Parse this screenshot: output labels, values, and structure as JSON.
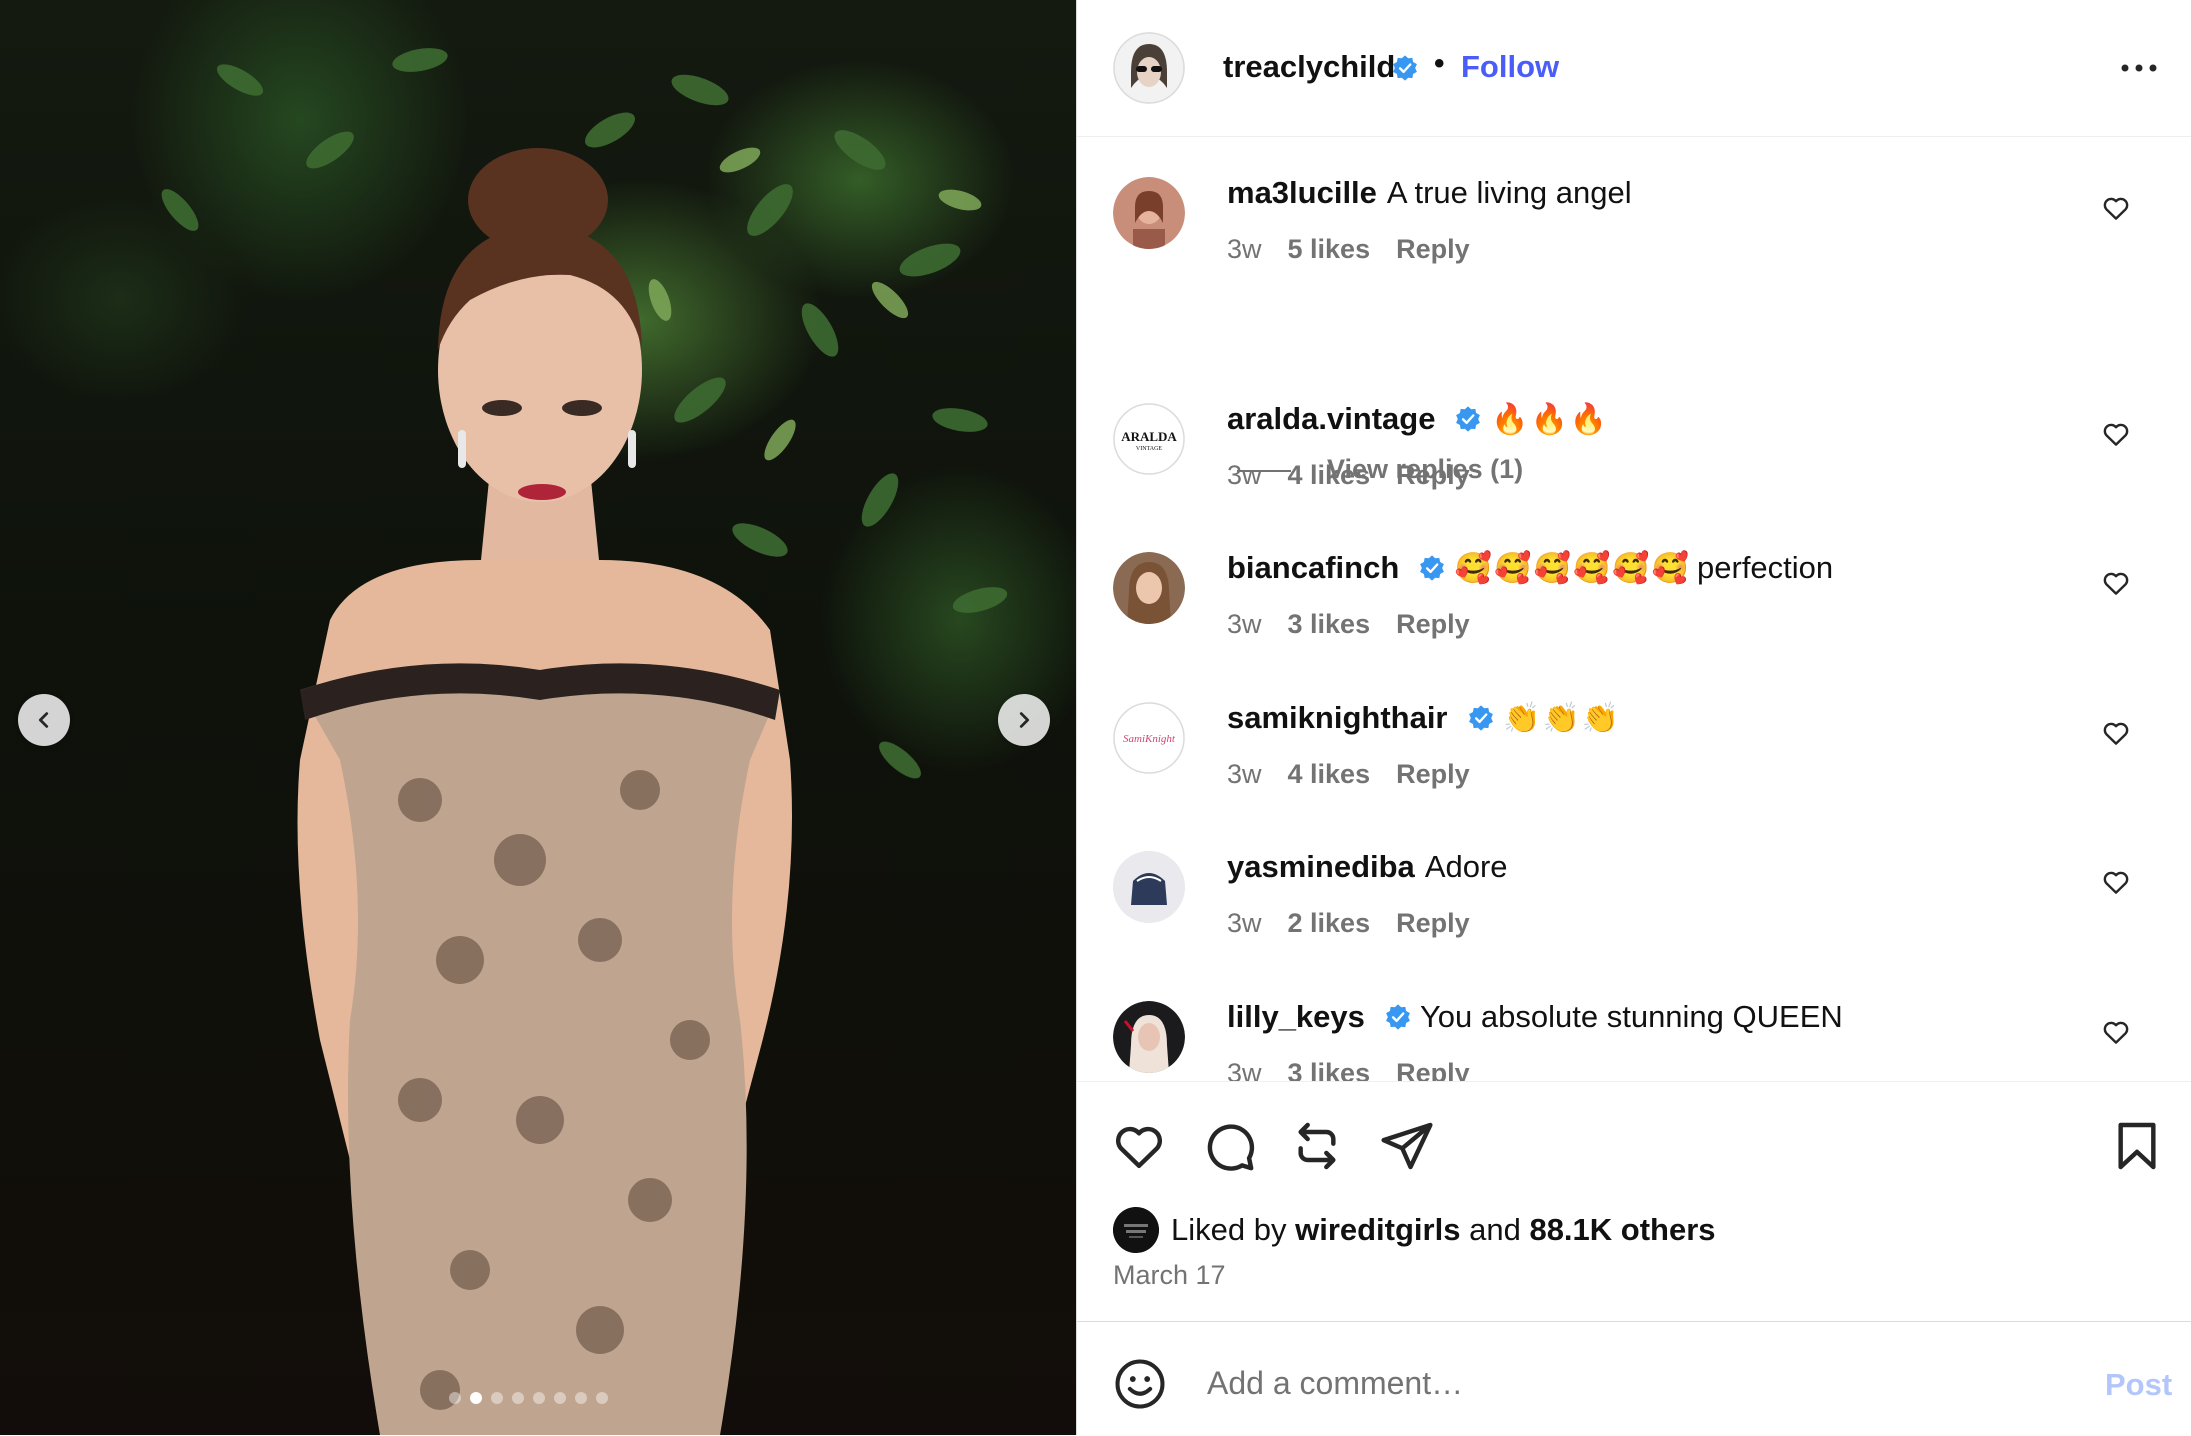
{
  "post": {
    "username": "treaclychild",
    "follow_label": "Follow",
    "separator": "•",
    "carousel_slide_count": 8,
    "carousel_active_index": 1
  },
  "comments": [
    {
      "username": "ma3lucille",
      "verified": false,
      "text": "A true living angel",
      "time": "3w",
      "likes": "5 likes",
      "reply": "Reply",
      "view_replies": "View replies (1)"
    },
    {
      "username": "aralda.vintage",
      "verified": true,
      "emoji": "🔥🔥🔥",
      "text": "",
      "time": "3w",
      "likes": "4 likes",
      "reply": "Reply",
      "avatar_text": "ARALDA",
      "avatar_subtext": "VINTAGE"
    },
    {
      "username": "biancafinch",
      "verified": true,
      "emoji": "🥰🥰🥰🥰🥰🥰",
      "text": "perfection",
      "time": "3w",
      "likes": "3 likes",
      "reply": "Reply"
    },
    {
      "username": "samiknighthair",
      "verified": true,
      "emoji": "👏👏👏",
      "text": "",
      "time": "3w",
      "likes": "4 likes",
      "reply": "Reply",
      "avatar_text": "SamiKnight"
    },
    {
      "username": "yasminediba",
      "verified": false,
      "text": "Adore",
      "time": "3w",
      "likes": "2 likes",
      "reply": "Reply"
    },
    {
      "username": "lilly_keys",
      "verified": true,
      "text": "You absolute stunning QUEEN",
      "time": "3w",
      "likes": "3 likes",
      "reply": "Reply"
    }
  ],
  "likes_summary": {
    "prefix": "Liked by",
    "user": "wireditgirls",
    "conjunction": "and",
    "others": "88.1K others"
  },
  "date": "March 17",
  "add_comment": {
    "placeholder": "Add a comment…",
    "post_label": "Post"
  },
  "colors": {
    "accent": "#4a5df9",
    "verified": "#3897f0",
    "muted": "#737373",
    "post_disabled": "#b2c6fb"
  }
}
